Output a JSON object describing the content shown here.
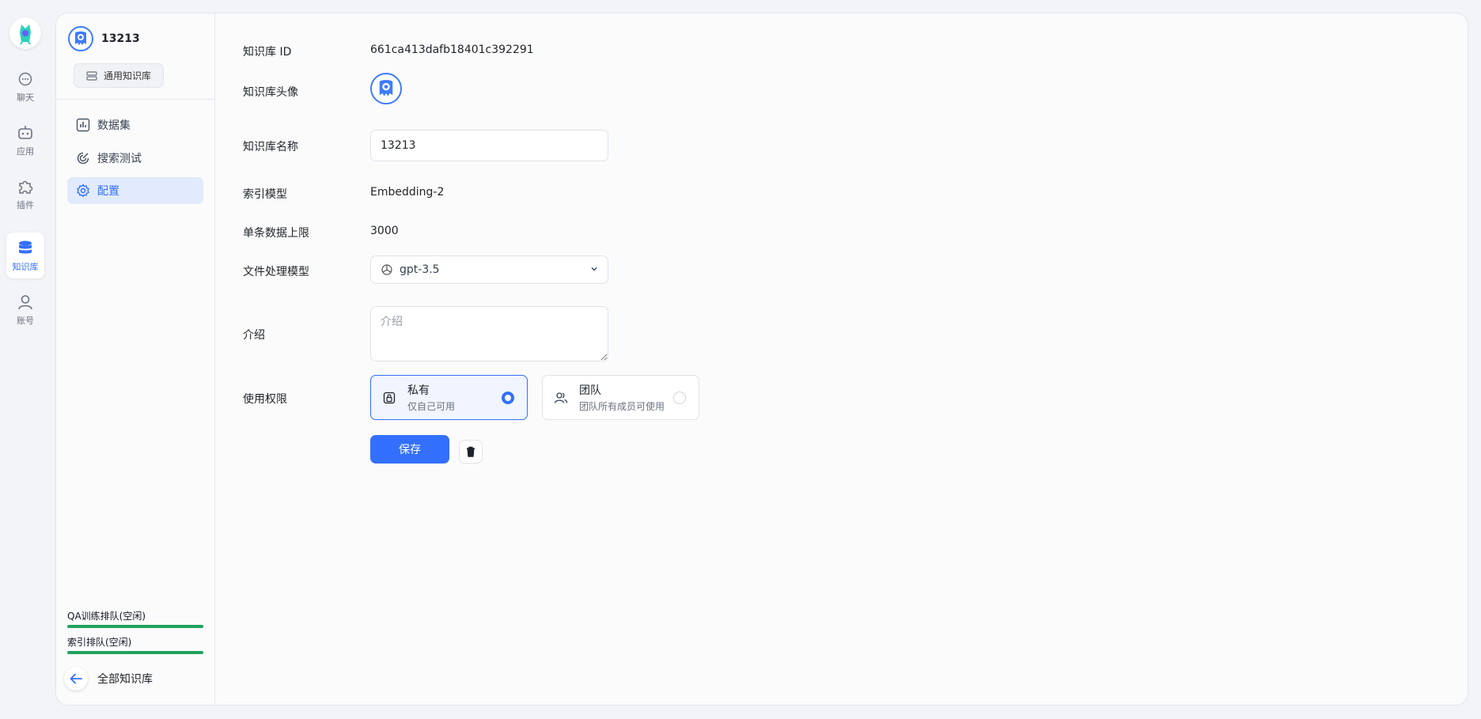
{
  "rail": {
    "items": [
      {
        "label": "聊天",
        "icon": "chat-icon"
      },
      {
        "label": "应用",
        "icon": "robot-icon"
      },
      {
        "label": "插件",
        "icon": "puzzle-icon"
      },
      {
        "label": "知识库",
        "icon": "database-icon"
      },
      {
        "label": "账号",
        "icon": "user-icon"
      }
    ],
    "active_index": 3
  },
  "sidebar": {
    "dataset_name": "13213",
    "dataset_type": "通用知识库",
    "nav": [
      {
        "label": "数据集",
        "icon": "chart-icon"
      },
      {
        "label": "搜索测试",
        "icon": "target-icon"
      },
      {
        "label": "配置",
        "icon": "gear-icon"
      }
    ],
    "active_nav": 2,
    "queues": [
      {
        "label": "QA训练排队(空闲)",
        "progress": 1.0
      },
      {
        "label": "索引排队(空闲)",
        "progress": 1.0
      }
    ],
    "back_label": "全部知识库"
  },
  "form": {
    "id_label": "知识库 ID",
    "id_value": "661ca413dafb18401c392291",
    "avatar_label": "知识库头像",
    "name_label": "知识库名称",
    "name_value": "13213",
    "index_model_label": "索引模型",
    "index_model_value": "Embedding-2",
    "limit_label": "单条数据上限",
    "limit_value": "3000",
    "file_model_label": "文件处理模型",
    "file_model_value": "gpt-3.5",
    "intro_label": "介绍",
    "intro_placeholder": "介绍",
    "permission_label": "使用权限",
    "permissions": [
      {
        "title": "私有",
        "desc": "仅自己可用",
        "selected": true
      },
      {
        "title": "团队",
        "desc": "团队所有成员可使用",
        "selected": false
      }
    ],
    "save_label": "保存"
  },
  "colors": {
    "accent": "#3370ff",
    "progress": "#20a35e",
    "active_bg": "#e2ebfd"
  }
}
